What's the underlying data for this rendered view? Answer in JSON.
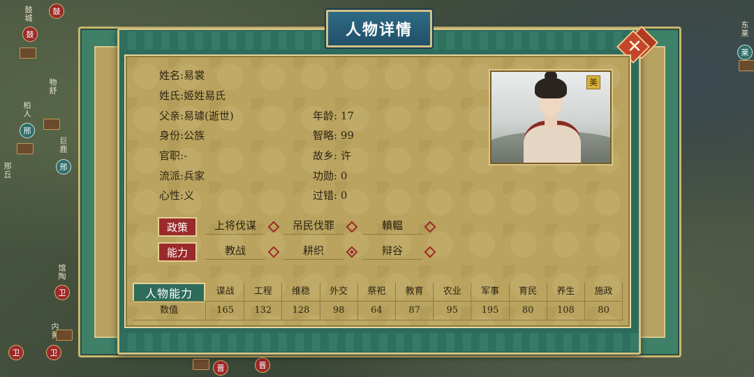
{
  "window_title": "人物详情",
  "profile": {
    "name_label": "姓名:",
    "name": "易裳",
    "clan_label": "姓氏:",
    "clan": "姬姓易氏",
    "father_label": "父亲:",
    "father": "易璩(逝世)",
    "identity_label": "身份:",
    "identity": "公族",
    "office_label": "官职:",
    "office": "-",
    "school_label": "流派:",
    "school": "兵家",
    "temper_label": "心性:",
    "temper": "义",
    "age_label": "年龄:",
    "age": "17",
    "strategy_label": "智略:",
    "strategy": "99",
    "hometown_label": "故乡:",
    "hometown": "许",
    "merit_label": "功勋:",
    "merit": "0",
    "fault_label": "过错:",
    "fault": "0"
  },
  "portrait_badge": "美",
  "policy": {
    "tag": "政策",
    "items": [
      {
        "label": "上将伐谋",
        "selected": false
      },
      {
        "label": "吊民伐罪",
        "selected": false
      },
      {
        "label": "轒輼",
        "selected": false
      }
    ]
  },
  "ability": {
    "tag": "能力",
    "items": [
      {
        "label": "教战",
        "selected": false
      },
      {
        "label": "耕织",
        "selected": true
      },
      {
        "label": "辩谷",
        "selected": false
      }
    ]
  },
  "stats_table": {
    "header": "人物能力",
    "row_label": "数值",
    "columns": [
      "谍战",
      "工程",
      "维稳",
      "外交",
      "祭祀",
      "教育",
      "农业",
      "军事",
      "育民",
      "养生",
      "施政"
    ],
    "values": [
      "165",
      "132",
      "128",
      "98",
      "64",
      "87",
      "95",
      "195",
      "80",
      "108",
      "80"
    ]
  },
  "map": {
    "labels": [
      "鼓城",
      "物舒",
      "柏人",
      "巨鹿",
      "邢丘",
      "馆陶",
      "内黄",
      "东莱"
    ],
    "badges": [
      "鼓",
      "鼓",
      "邢",
      "邢",
      "卫",
      "卫",
      "卫",
      "晋",
      "晋",
      "莱"
    ]
  },
  "colors": {
    "frame_green": "#2d6b5c",
    "parchment": "#b9a35f",
    "title_blue": "#2f6a84",
    "tag_red": "#9b2a2a",
    "gold_border": "#d4c283"
  }
}
